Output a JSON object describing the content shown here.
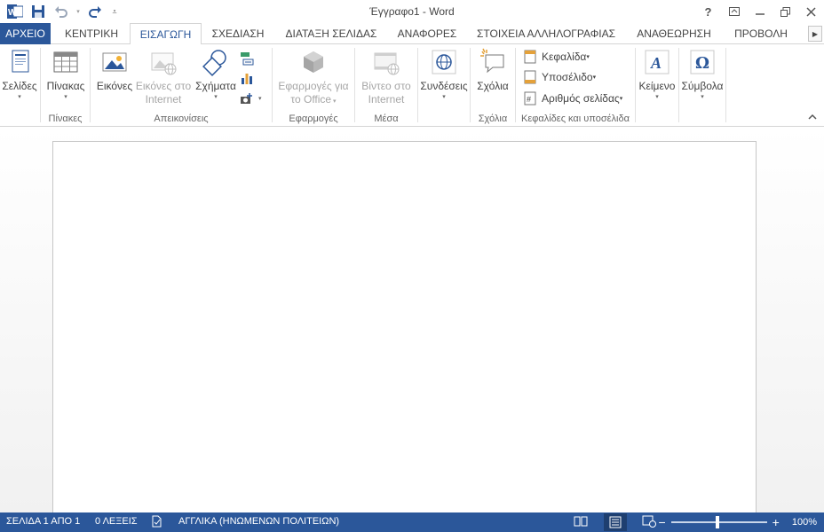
{
  "window": {
    "title": "Έγγραφο1 - Word"
  },
  "tabs": {
    "file": "ΑΡΧΕΙΟ",
    "home": "ΚΕΝΤΡΙΚΗ",
    "insert": "ΕΙΣΑΓΩΓΗ",
    "design": "ΣΧΕΔΙΑΣΗ",
    "layout": "ΔΙΑΤΑΞΗ ΣΕΛΙΔΑΣ",
    "references": "ΑΝΑΦΟΡΕΣ",
    "mailings": "ΣΤΟΙΧΕΙΑ ΑΛΛΗΛΟΓΡΑΦΙΑΣ",
    "review": "ΑΝΑΘΕΩΡΗΣΗ",
    "view": "ΠΡΟΒΟΛΗ"
  },
  "ribbon": {
    "pages": {
      "label": "Σελίδες"
    },
    "tables": {
      "button": "Πίνακας",
      "group": "Πίνακες"
    },
    "illustrations": {
      "pictures": "Εικόνες",
      "online_pictures_1": "Εικόνες στο",
      "online_pictures_2": "Internet",
      "shapes": "Σχήματα",
      "group": "Απεικονίσεις"
    },
    "apps": {
      "line1": "Εφαρμογές για",
      "line2": "το Office",
      "group": "Εφαρμογές"
    },
    "media": {
      "line1": "Βίντεο στο",
      "line2": "Internet",
      "group": "Μέσα"
    },
    "links": {
      "button": "Συνδέσεις"
    },
    "comments": {
      "button": "Σχόλια",
      "group": "Σχόλια"
    },
    "header_footer": {
      "header": "Κεφαλίδα",
      "footer": "Υποσέλιδο",
      "page_number": "Αριθμός σελίδας",
      "group": "Κεφαλίδες και υποσέλιδα"
    },
    "text": {
      "button": "Κείμενο"
    },
    "symbols": {
      "button": "Σύμβολα"
    }
  },
  "status": {
    "page": "ΣΕΛΙΔΑ 1 ΑΠΟ 1",
    "words": "0 ΛΕΞΕΙΣ",
    "language": "ΑΓΓΛΙΚΑ (ΗΝΩΜΕΝΩΝ ΠΟΛΙΤΕΙΩΝ)",
    "zoom": "100%"
  },
  "colors": {
    "accent": "#2b579a",
    "ribbon_icon_blue": "#2b579a",
    "status_bg": "#2b579a"
  }
}
